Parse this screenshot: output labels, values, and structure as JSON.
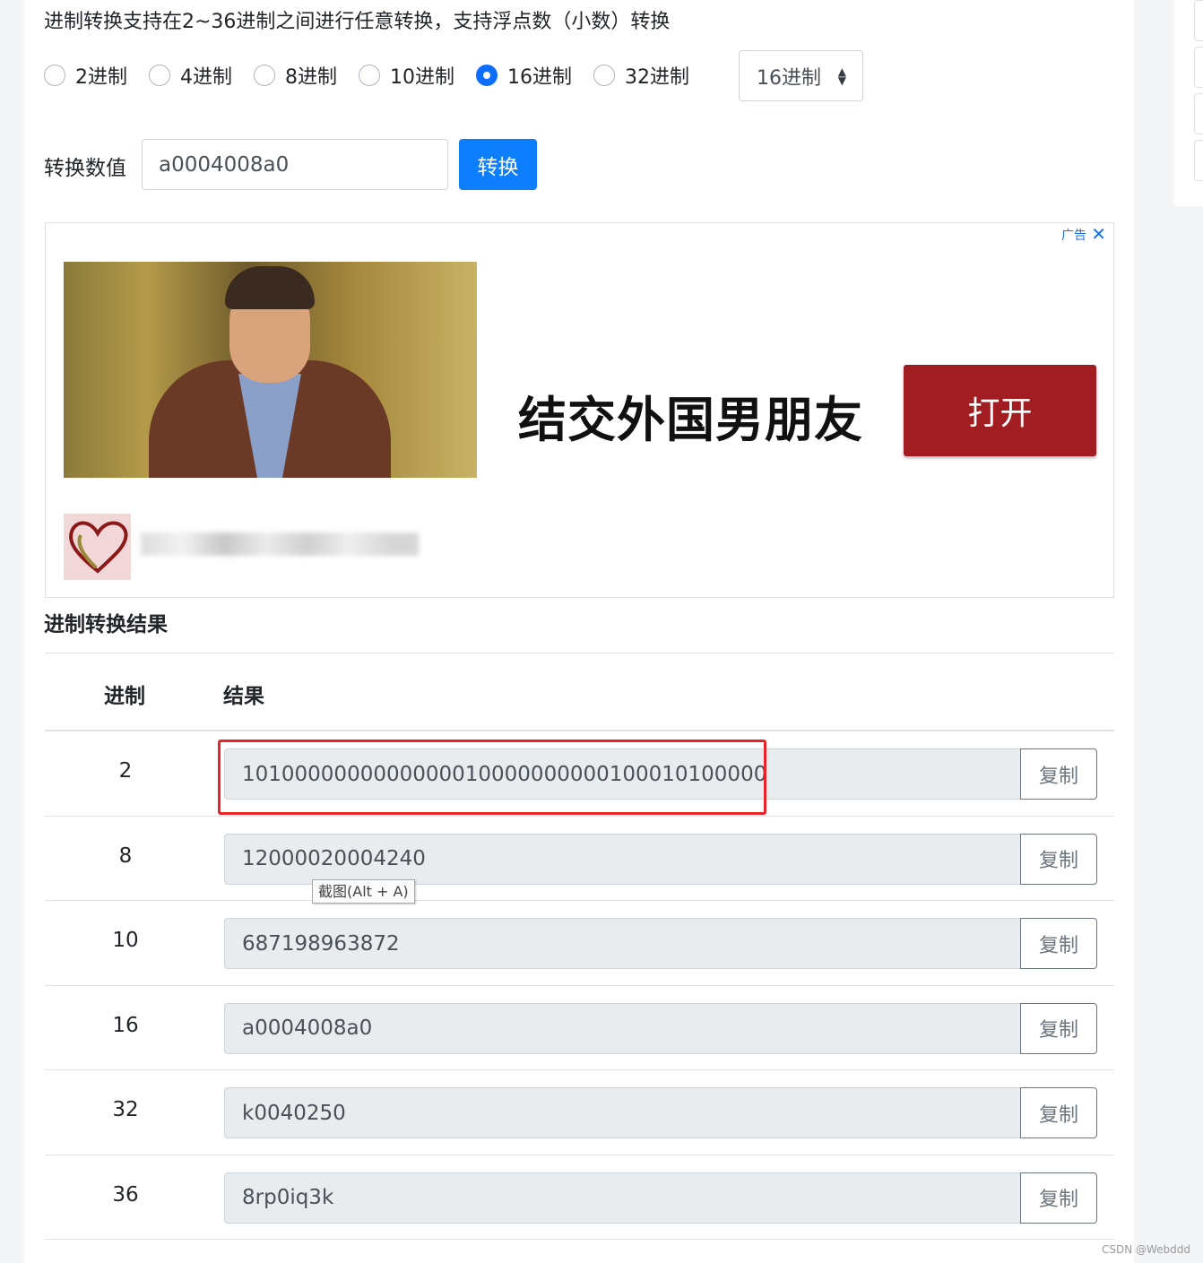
{
  "intro": "进制转换支持在2~36进制之间进行任意转换，支持浮点数（小数）转换",
  "radios": [
    {
      "label": "2进制",
      "checked": false
    },
    {
      "label": "4进制",
      "checked": false
    },
    {
      "label": "8进制",
      "checked": false
    },
    {
      "label": "10进制",
      "checked": false
    },
    {
      "label": "16进制",
      "checked": true
    },
    {
      "label": "32进制",
      "checked": false
    }
  ],
  "select": {
    "value": "16进制"
  },
  "convert": {
    "label": "转换数值",
    "input_value": "a0004008a0",
    "button": "转换"
  },
  "ad": {
    "tag": "广告",
    "close": "✕",
    "headline": "结交外国男朋友",
    "open_button": "打开"
  },
  "results": {
    "title": "进制转换结果",
    "headers": {
      "radix": "进制",
      "result": "结果"
    },
    "copy_label": "复制",
    "rows": [
      {
        "radix": "2",
        "value": "1010000000000000010000000000100010100000"
      },
      {
        "radix": "8",
        "value": "12000020004240"
      },
      {
        "radix": "10",
        "value": "687198963872"
      },
      {
        "radix": "16",
        "value": "a0004008a0"
      },
      {
        "radix": "32",
        "value": "k0040250"
      },
      {
        "radix": "36",
        "value": "8rp0iq3k"
      }
    ]
  },
  "tooltip": "截图(Alt + A)",
  "watermark": "CSDN @Webddd",
  "colors": {
    "accent": "#0d7efd",
    "ad_button": "#a11d22",
    "highlight": "#e8232a"
  }
}
